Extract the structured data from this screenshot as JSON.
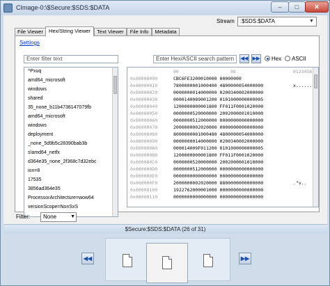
{
  "window": {
    "title": "CImage-0:\\$Secure:$SDS:$DATA"
  },
  "stream": {
    "label": "Stream",
    "value": ":$SDS:$DATA"
  },
  "tabs": [
    {
      "label": "File Viewer"
    },
    {
      "label": "Hex/String Viewer"
    },
    {
      "label": "Text Viewer"
    },
    {
      "label": "File Info"
    },
    {
      "label": "Metadata"
    }
  ],
  "panel": {
    "settings_label": "Settings",
    "filter_placeholder": "Enter filter text",
    "search_placeholder": "Enter Hex/ASCII search pattern",
    "radio_hex": "Hex",
    "radio_ascii": "ASCII"
  },
  "strings_list": [
    "^Pxuq",
    "amd64_microsoft",
    "windows",
    "shared",
    "35_none_b11b4738147079fb",
    "amd64_microsoft",
    "windows",
    "deployment",
    "_none_5d9b5c28390bab3b",
    "s\\amd64_netfx",
    "d364e35_none_2f368c7d32ebc",
    "ion=8",
    "17535",
    "3856ad364e35",
    "ProcessorArchitecture=wow64",
    "versionScope=NonSxS"
  ],
  "hex": {
    "header_offset": "00",
    "header_data": "08",
    "header_ascii": "01234567",
    "rows": [
      {
        "offset": "0x00000000",
        "data": "CBC6FE3200010000 00000000",
        "ascii": ""
      },
      {
        "offset": "0x00000010",
        "data": "7800000001000400 4800000054000000",
        "ascii": "x......"
      },
      {
        "offset": "0x00000020",
        "data": "0000000014000000 0200340002000000",
        "ascii": ""
      },
      {
        "offset": "0x00000030",
        "data": "0000140089001200 0101000000000005",
        "ascii": ""
      },
      {
        "offset": "0x00000040",
        "data": "1200000000001800 FF011F0001020000",
        "ascii": ""
      },
      {
        "offset": "0x00000050",
        "data": "0000000520000000 2002000001010000",
        "ascii": ""
      },
      {
        "offset": "0x00000060",
        "data": "0000000512000000 0000000000000000",
        "ascii": ""
      },
      {
        "offset": "0x00000070",
        "data": "2000000002020000 0000000000000000",
        "ascii": ""
      },
      {
        "offset": "0x00000080",
        "data": "8000000001000480 4800000054000000",
        "ascii": ""
      },
      {
        "offset": "0x00000090",
        "data": "0000000014000000 0200340002000000",
        "ascii": ""
      },
      {
        "offset": "0x000000A0",
        "data": "000014009F011200 0101000000000005",
        "ascii": ""
      },
      {
        "offset": "0x000000B0",
        "data": "1200000000001800 FF011F0001020000",
        "ascii": ""
      },
      {
        "offset": "0x000000C0",
        "data": "0000000520000000 2002000001010000",
        "ascii": ""
      },
      {
        "offset": "0x000000D0",
        "data": "0000000512000000 0000000000000000",
        "ascii": ""
      },
      {
        "offset": "0x000000E0",
        "data": "0000000000000000 0000000000000000",
        "ascii": ""
      },
      {
        "offset": "0x000000F0",
        "data": "2000000002020000 8800000000000000",
        "ascii": ".\"v.."
      },
      {
        "offset": "0x00000100",
        "data": "1922762000001000 0000000000000000",
        "ascii": ""
      },
      {
        "offset": "0x00000110",
        "data": "0000000000000000 0000000000000000",
        "ascii": ""
      }
    ]
  },
  "filter": {
    "label": "Filter:",
    "value": "None"
  },
  "status": {
    "text": "$Secure:$SDS:$DATA (26 of 31)"
  },
  "icons": {
    "first": "first-icon",
    "last": "last-icon",
    "prev": "prev-icon",
    "next": "next-icon",
    "document": "document-icon"
  }
}
